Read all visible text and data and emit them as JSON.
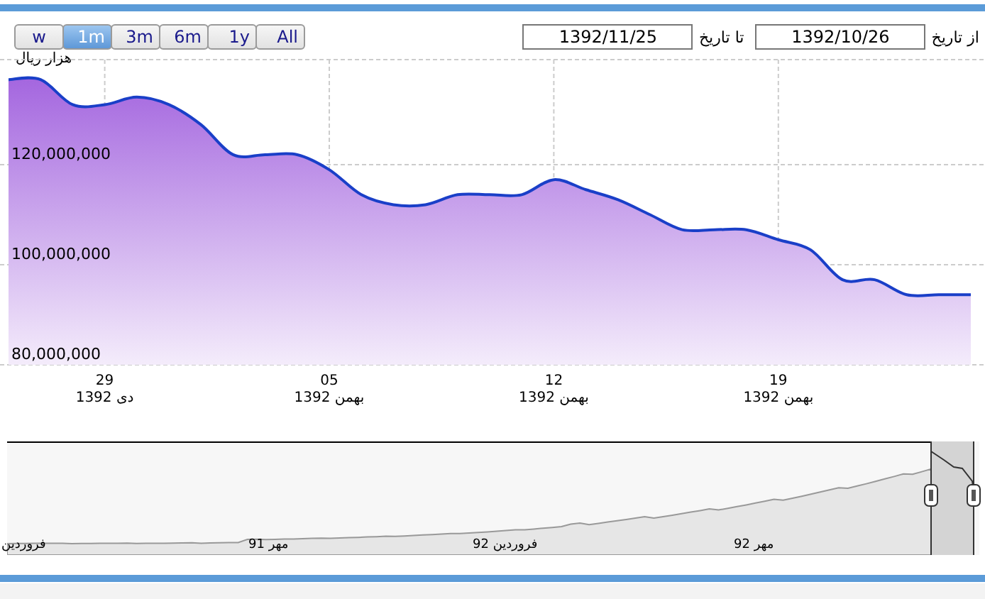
{
  "range_buttons": [
    {
      "label": "All",
      "selected": false
    },
    {
      "label": "1y",
      "selected": false
    },
    {
      "label": "6m",
      "selected": false
    },
    {
      "label": "3m",
      "selected": false
    },
    {
      "label": "1m",
      "selected": true
    },
    {
      "label": "w",
      "selected": false
    }
  ],
  "unit_label": "هزار ریال",
  "date_from": {
    "label": "از تاریخ",
    "value": "1392/10/26"
  },
  "date_to": {
    "label": "تا تاریخ",
    "value": "1392/11/25"
  },
  "chart_data": {
    "type": "area",
    "categories": [
      null,
      null,
      null,
      "29\nدی 1392",
      null,
      null,
      null,
      null,
      null,
      null,
      "05\nبهمن 1392",
      null,
      null,
      null,
      null,
      null,
      null,
      "12\nبهمن 1392",
      null,
      null,
      null,
      null,
      null,
      null,
      "19\nبهمن 1392",
      null,
      null,
      null,
      null,
      null,
      null
    ],
    "series": [
      {
        "color": "#1a3fc8",
        "values": [
          137000000,
          137000000,
          132000000,
          132000000,
          133500000,
          132000000,
          128000000,
          122000000,
          122000000,
          122000000,
          119000000,
          114000000,
          112000000,
          112000000,
          114000000,
          114000000,
          114000000,
          117000000,
          115000000,
          113000000,
          110000000,
          107000000,
          107000000,
          107000000,
          105000000,
          103000000,
          97000000,
          97000000,
          94000000,
          94000000,
          94000000
        ]
      }
    ],
    "ylim": [
      80000000,
      141000000
    ],
    "grid": true,
    "yticks": [
      {
        "value": 80000000,
        "label": "80,000,000"
      },
      {
        "value": 100000000,
        "label": "100,000,000"
      },
      {
        "value": 120000000,
        "label": "120,000,000"
      }
    ]
  },
  "navigator": {
    "labels": [
      "مهر 92",
      "فروردین 92",
      "مهر 91",
      "فروردین"
    ]
  }
}
